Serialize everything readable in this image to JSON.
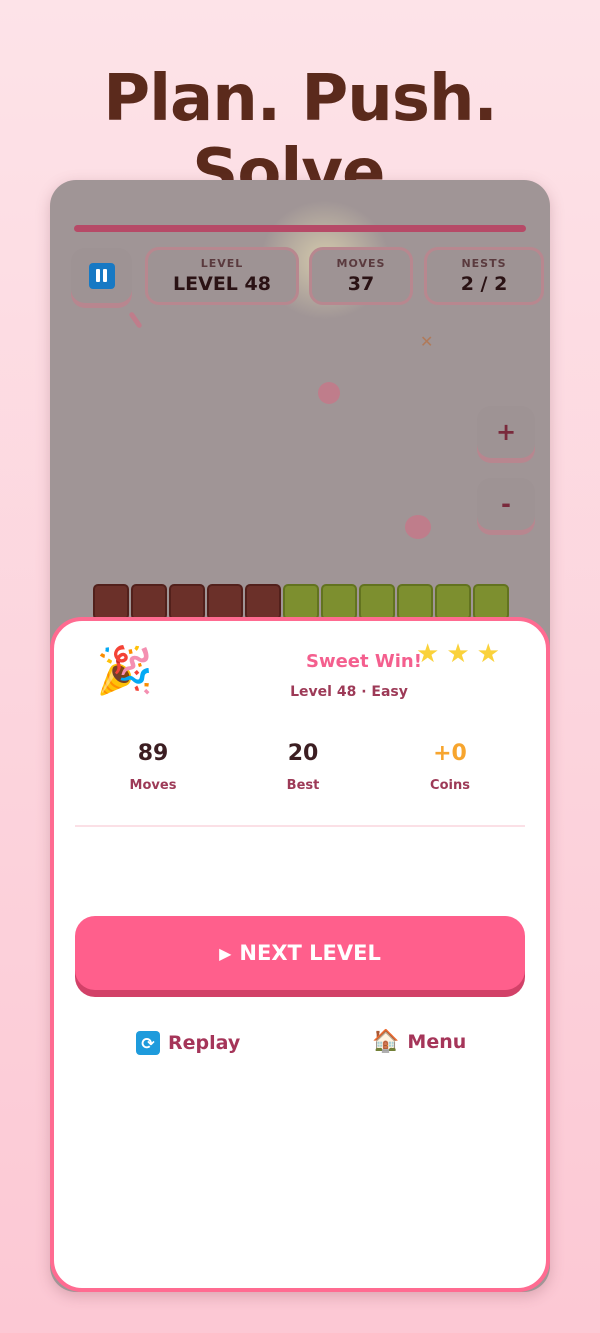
{
  "headline": "Plan. Push. Solve.",
  "hud": {
    "level_label": "LEVEL",
    "level_value": "LEVEL 48",
    "moves_label": "MOVES",
    "moves_value": "37",
    "nests_label": "NESTS",
    "nests_value": "2 / 2",
    "pause_icon": "pause-icon"
  },
  "zoom": {
    "plus": "+",
    "minus": "-"
  },
  "board": {
    "blocks": [
      "chocolate",
      "chocolate",
      "chocolate",
      "chocolate",
      "chocolate",
      "green",
      "green",
      "green",
      "green",
      "green",
      "green"
    ]
  },
  "result": {
    "icon": "🎉",
    "title": "Sweet Win!",
    "stars_earned": 3,
    "star_glyph": "★",
    "level_line": "Level 48 · Easy",
    "stats": [
      {
        "value": "89",
        "caption": "Moves"
      },
      {
        "value": "20",
        "caption": "Best"
      },
      {
        "value": "+0",
        "caption": "Coins"
      }
    ],
    "next_icon": "▶",
    "next_label": "NEXT LEVEL",
    "replay_icon": "🔄",
    "replay_label": "Replay",
    "menu_icon": "🏠",
    "menu_label": "Menu"
  },
  "colors": {
    "accent": "#ff5f8c",
    "headline": "#5b2a1c",
    "coins": "#f7a52e"
  }
}
